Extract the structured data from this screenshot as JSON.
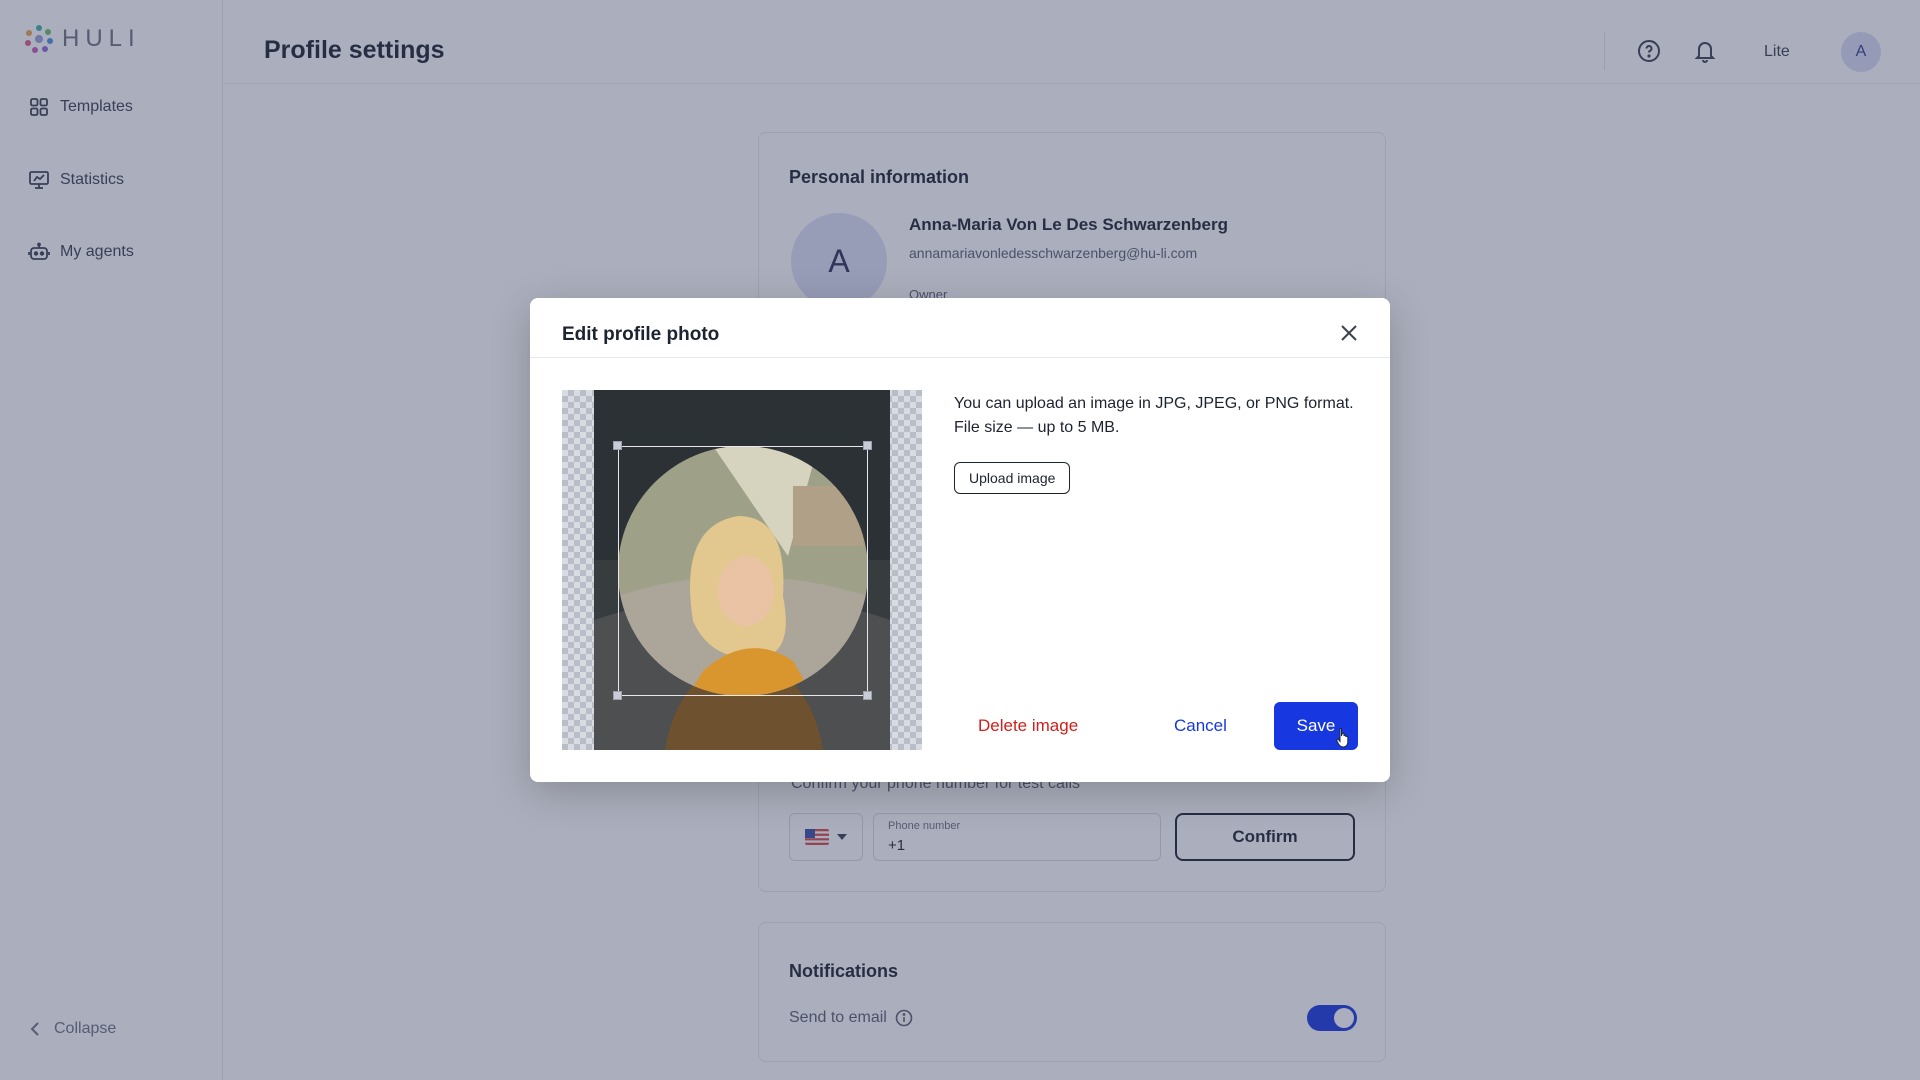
{
  "app": {
    "brand": "HULI"
  },
  "sidebar": {
    "items": [
      {
        "label": "Templates",
        "icon": "grid-icon"
      },
      {
        "label": "Statistics",
        "icon": "chart-monitor-icon"
      },
      {
        "label": "My agents",
        "icon": "robot-icon"
      }
    ],
    "collapse_label": "Collapse"
  },
  "header": {
    "title": "Profile settings",
    "plan": "Lite",
    "avatar_initial": "A"
  },
  "personal_info": {
    "title": "Personal information",
    "avatar_initial": "A",
    "name": "Anna-Maria Von Le Des Schwarzenberg",
    "email": "annamariavonledesschwarzenberg@hu-li.com",
    "role": "Owner"
  },
  "phone": {
    "hint": "Confirm your phone number for test calls",
    "field_label": "Phone number",
    "field_value": "+1",
    "confirm_label": "Confirm"
  },
  "notifications": {
    "title": "Notifications",
    "send_to_email_label": "Send to email",
    "send_to_email_enabled": true
  },
  "modal": {
    "title": "Edit profile photo",
    "description_line1": "You can upload an image in JPG, JPEG, or PNG format.",
    "description_line2": "File size — up to 5 MB.",
    "upload_label": "Upload image",
    "delete_label": "Delete image",
    "cancel_label": "Cancel",
    "save_label": "Save"
  },
  "colors": {
    "accent": "#1738e0",
    "danger": "#d0201b",
    "overlay": "#383e60"
  }
}
